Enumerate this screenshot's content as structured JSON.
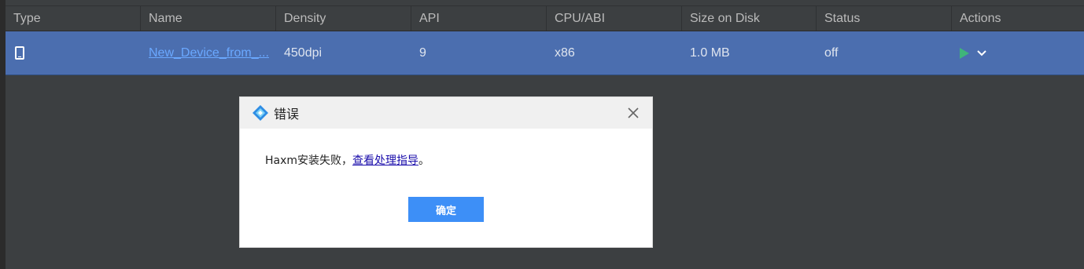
{
  "table": {
    "headers": {
      "type": "Type",
      "name": "Name",
      "density": "Density",
      "api": "API",
      "cpu": "CPU/ABI",
      "size": "Size on Disk",
      "status": "Status",
      "actions": "Actions"
    },
    "rows": [
      {
        "type_icon": "phone-icon",
        "name": "New_Device_from_...",
        "density": "450dpi",
        "api": "9",
        "cpu": "x86",
        "size": "1.0 MB",
        "status": "off"
      }
    ]
  },
  "dialog": {
    "title": "错误",
    "message_prefix": "Haxm安装失败，",
    "message_link": "查看处理指导",
    "message_suffix": "。",
    "ok_label": "确定"
  },
  "colors": {
    "background": "#3c3f41",
    "selected_row": "#4b6eaf",
    "play": "#3fb57a",
    "ok_button": "#3d8ff7"
  }
}
